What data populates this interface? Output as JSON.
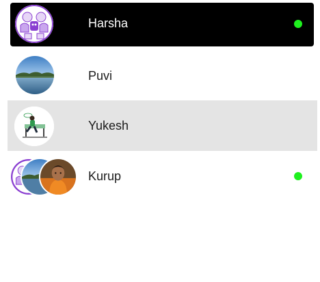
{
  "chats": [
    {
      "name": "Harsha",
      "online": true,
      "selected": true,
      "avatar_icon": "cartoon-faces-avatar"
    },
    {
      "name": "Puvi",
      "online": false,
      "selected": false,
      "avatar_icon": "lake-landscape-avatar"
    },
    {
      "name": "Yukesh",
      "online": false,
      "selected": false,
      "hovered": true,
      "avatar_icon": "illustration-person-on-bench-avatar"
    },
    {
      "name": "Kurup",
      "online": true,
      "selected": false,
      "group": true,
      "avatar_icons": [
        "cartoon-faces-avatar",
        "lake-landscape-avatar",
        "portrait-photo-avatar"
      ]
    }
  ],
  "colors": {
    "selected_bg": "#000000",
    "hover_bg": "#e4e4e4",
    "online_dot": "#1ef01e",
    "selected_text": "#ffffff",
    "text": "#1a1a1a"
  }
}
